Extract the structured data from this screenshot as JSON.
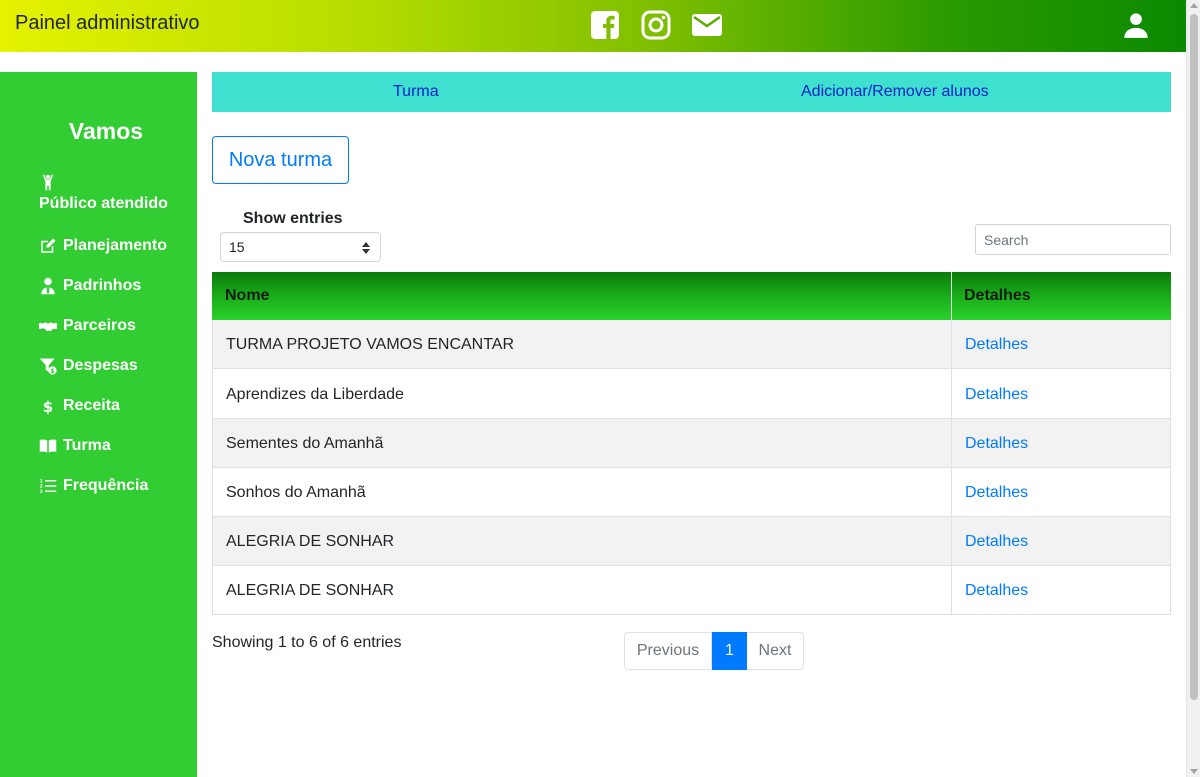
{
  "header": {
    "title": "Painel administrativo",
    "icons": [
      "facebook-icon",
      "instagram-icon",
      "mail-icon",
      "user-icon"
    ],
    "gradient_colors": [
      "#e5f200",
      "#0a8a00"
    ]
  },
  "sidebar": {
    "title": "Vamos",
    "bg_color": "#32cd32",
    "items": [
      {
        "label": "Público atendido",
        "icon": "person-raised-arms-icon"
      },
      {
        "label": "Planejamento",
        "icon": "edit-icon"
      },
      {
        "label": "Padrinhos",
        "icon": "user-tie-icon"
      },
      {
        "label": "Parceiros",
        "icon": "handshake-icon"
      },
      {
        "label": "Despesas",
        "icon": "filter-dollar-icon"
      },
      {
        "label": "Receita",
        "icon": "dollar-icon"
      },
      {
        "label": "Turma",
        "icon": "book-open-icon"
      },
      {
        "label": "Frequência",
        "icon": "list-ordered-icon"
      }
    ]
  },
  "tabs": {
    "bg_color": "#40e0d0",
    "items": [
      "Turma",
      "Adicionar/Remover alunos"
    ]
  },
  "actions": {
    "new_class_label": "Nova turma"
  },
  "table_controls": {
    "show_entries_label": "Show entries",
    "entries_value": "15",
    "search_placeholder": "Search"
  },
  "table": {
    "columns": [
      "Nome",
      "Detalhes"
    ],
    "rows": [
      {
        "name": "TURMA PROJETO VAMOS ENCANTAR",
        "link": "Detalhes"
      },
      {
        "name": "Aprendizes da Liberdade",
        "link": "Detalhes"
      },
      {
        "name": "Sementes do Amanhã",
        "link": "Detalhes"
      },
      {
        "name": "Sonhos do Amanhã",
        "link": "Detalhes"
      },
      {
        "name": "ALEGRIA DE SONHAR",
        "link": "Detalhes"
      },
      {
        "name": "ALEGRIA DE SONHAR",
        "link": "Detalhes"
      }
    ]
  },
  "footer": {
    "info": "Showing 1 to 6 of 6 entries",
    "pagination": {
      "previous": "Previous",
      "current": "1",
      "next": "Next"
    }
  }
}
